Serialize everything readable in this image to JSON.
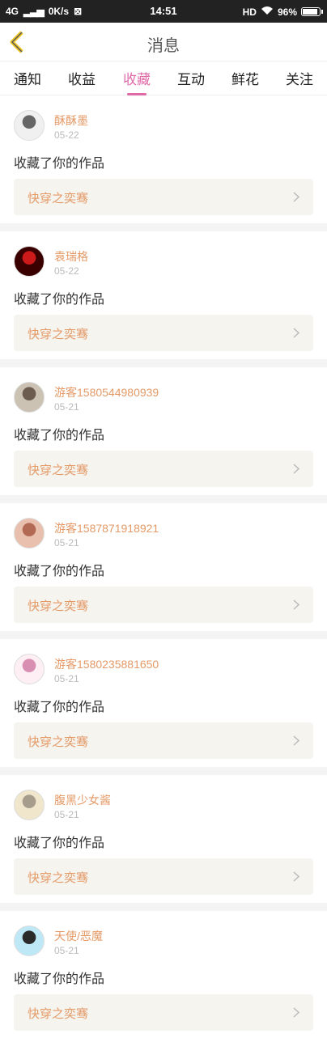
{
  "status": {
    "network": "4G",
    "speed": "0K/s",
    "time": "14:51",
    "hd": "HD",
    "battery": "96%",
    "battery_level": 0.96
  },
  "header": {
    "title": "消息"
  },
  "tabs": [
    {
      "label": "通知",
      "active": false
    },
    {
      "label": "收益",
      "active": false
    },
    {
      "label": "收藏",
      "active": true
    },
    {
      "label": "互动",
      "active": false
    },
    {
      "label": "鲜花",
      "active": false
    },
    {
      "label": "关注",
      "active": false
    }
  ],
  "messages": [
    {
      "user": "酥酥墨",
      "date": "05-22",
      "action": "收藏了你的作品",
      "work": "快穿之奕骞",
      "avatar_colors": [
        "#f0f0f0",
        "#666"
      ]
    },
    {
      "user": "袁瑞格",
      "date": "05-22",
      "action": "收藏了你的作品",
      "work": "快穿之奕骞",
      "avatar_colors": [
        "#3a0000",
        "#cc1a1a"
      ]
    },
    {
      "user": "游客1580544980939",
      "date": "05-21",
      "action": "收藏了你的作品",
      "work": "快穿之奕骞",
      "avatar_colors": [
        "#ccc2b3",
        "#6c5b4f"
      ]
    },
    {
      "user": "游客1587871918921",
      "date": "05-21",
      "action": "收藏了你的作品",
      "work": "快穿之奕骞",
      "avatar_colors": [
        "#e9bfae",
        "#b36a55"
      ]
    },
    {
      "user": "游客1580235881650",
      "date": "05-21",
      "action": "收藏了你的作品",
      "work": "快穿之奕骞",
      "avatar_colors": [
        "#fdeff3",
        "#d98fb2"
      ]
    },
    {
      "user": "腹黑少女酱",
      "date": "05-21",
      "action": "收藏了你的作品",
      "work": "快穿之奕骞",
      "avatar_colors": [
        "#efe6cc",
        "#a79d8c"
      ]
    },
    {
      "user": "天使/恶魔",
      "date": "05-21",
      "action": "收藏了你的作品",
      "work": "快穿之奕骞",
      "avatar_colors": [
        "#bfe8f6",
        "#2a2a2a"
      ]
    }
  ],
  "colors": {
    "accent_tab": "#e06aa8",
    "username": "#e49a67",
    "work_title": "#e49a67",
    "work_bg": "#f5f4ef"
  }
}
